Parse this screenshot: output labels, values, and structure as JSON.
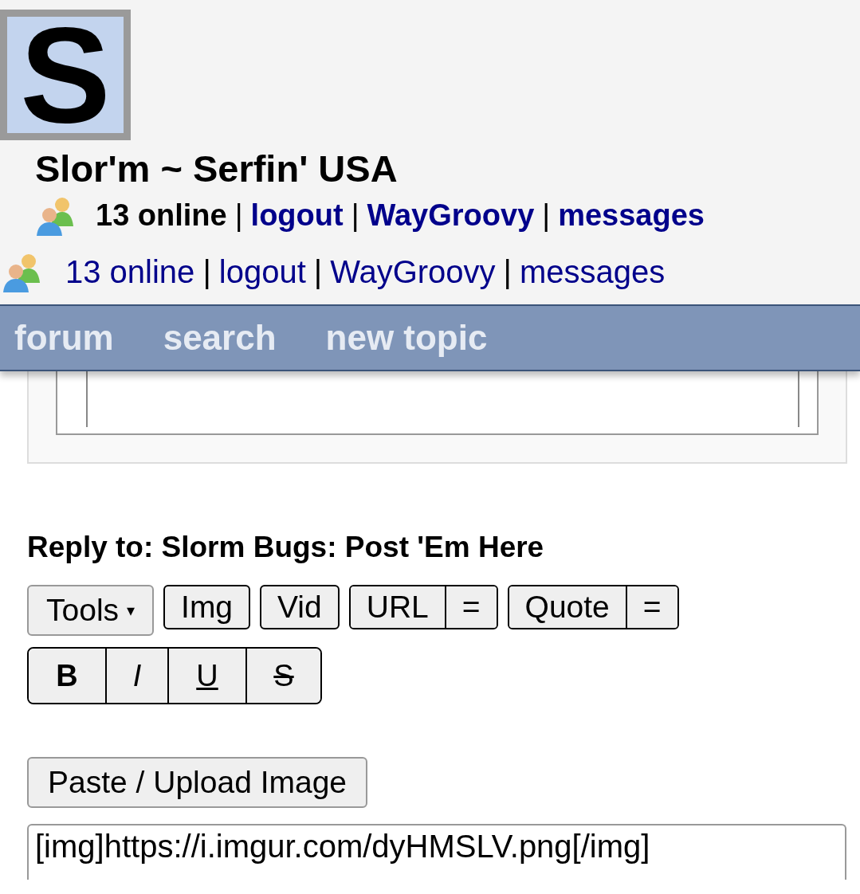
{
  "logo": {
    "letter": "S"
  },
  "site_title": "Slor'm ~ Serfin' USA",
  "status_lines": [
    {
      "kind": "bold",
      "online": "13 online",
      "separator": "|",
      "links": [
        "logout",
        "WayGroovy",
        "messages"
      ]
    },
    {
      "kind": "plain",
      "online": "13 online",
      "separator": "|",
      "links": [
        "logout",
        "WayGroovy",
        "messages"
      ]
    }
  ],
  "nav": [
    "forum",
    "search",
    "new topic"
  ],
  "reply_heading": "Reply to: Slorm Bugs: Post 'Em Here",
  "toolbar": [
    {
      "kind": "dropdown",
      "label": "Tools",
      "caret": "▾"
    },
    {
      "kind": "single",
      "label": "Img"
    },
    {
      "kind": "single",
      "label": "Vid"
    },
    {
      "kind": "split",
      "label": "URL",
      "extra": "="
    },
    {
      "kind": "split",
      "label": "Quote",
      "extra": "="
    }
  ],
  "format_buttons": [
    {
      "label": "B",
      "kind": "bold"
    },
    {
      "label": "I",
      "kind": "italic"
    },
    {
      "label": "U",
      "kind": "underline"
    },
    {
      "label": "S",
      "kind": "strike"
    }
  ],
  "upload_button": "Paste / Upload Image",
  "message": {
    "value": "[img]https://i.imgur.com/dyHMSLV.png[/img]"
  }
}
